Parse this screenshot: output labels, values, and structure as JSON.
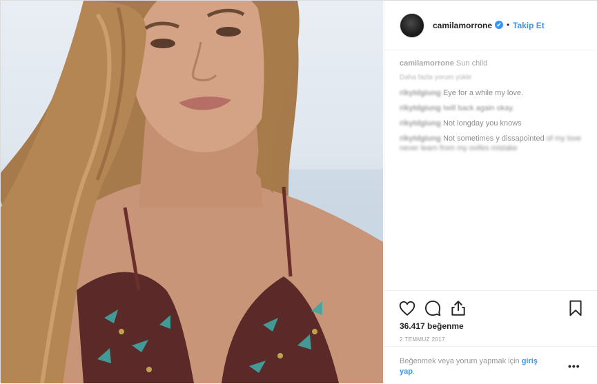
{
  "photo": {
    "alt_icon": "portrait-photo"
  },
  "header": {
    "username": "camilamorrone",
    "verified_badge": "✔",
    "separator": "•",
    "follow_label": "Takip Et"
  },
  "caption": {
    "username": "camilamorrone",
    "text": "Sun child"
  },
  "load_more": "Daha fazla yorum yükle",
  "comments": [
    {
      "user": "rikytdgiung",
      "text": "Eye for a while my love."
    },
    {
      "user": "rikytdgiung",
      "text": "Iwill back again okay."
    },
    {
      "user": "rikytdgiung",
      "text": "Not longday you knows"
    },
    {
      "user": "rikytdgiung",
      "text": "Not sometimes y dissapointed",
      "text2": "of my love never learn from my ovifes mistake"
    }
  ],
  "actions": {
    "likes": "36.417 beğenme",
    "date": "2 TEMMUZ 2017",
    "login_prefix": "Beğenmek veya yorum yapmak için ",
    "login_link": "giriş yap",
    "login_suffix": ".",
    "more": "•••"
  },
  "colors": {
    "accent": "#3897f0",
    "text": "#262626",
    "muted": "#999999",
    "border": "#efefef"
  }
}
